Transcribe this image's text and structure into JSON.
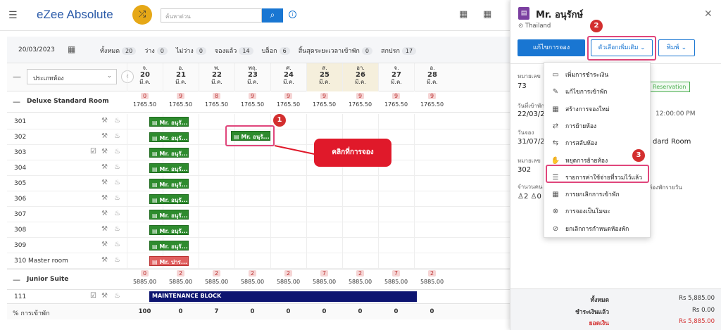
{
  "app": {
    "logo": "eZee Absolute",
    "search_placeholder": "ค้นหาด่วน"
  },
  "filter": {
    "date": "20/03/2023",
    "stats": [
      {
        "label": "ทั้งหมด",
        "value": "20"
      },
      {
        "label": "ว่าง",
        "value": "0"
      },
      {
        "label": "ไม่ว่าง",
        "value": "0"
      },
      {
        "label": "จองแล้ว",
        "value": "14"
      },
      {
        "label": "บล็อก",
        "value": "6"
      },
      {
        "label": "สิ้นสุดระยะเวลาเข้าพัก",
        "value": "0"
      },
      {
        "label": "สกปรก",
        "value": "17"
      }
    ]
  },
  "grid": {
    "room_type_select": "ประเภทห้อง",
    "days": [
      {
        "dow": "จ.",
        "num": "20",
        "mon": "มี.ค."
      },
      {
        "dow": "อ.",
        "num": "21",
        "mon": "มี.ค."
      },
      {
        "dow": "พ.",
        "num": "22",
        "mon": "มี.ค."
      },
      {
        "dow": "พฤ.",
        "num": "23",
        "mon": "มี.ค."
      },
      {
        "dow": "ศ.",
        "num": "24",
        "mon": "มี.ค."
      },
      {
        "dow": "ส.",
        "num": "25",
        "mon": "มี.ค."
      },
      {
        "dow": "อา.",
        "num": "26",
        "mon": "มี.ค."
      },
      {
        "dow": "จ.",
        "num": "27",
        "mon": "มี.ค."
      },
      {
        "dow": "อ.",
        "num": "28",
        "mon": "มี.ค."
      }
    ],
    "deluxe": {
      "name": "Deluxe Standard Room",
      "counts": [
        "0",
        "9",
        "8",
        "9",
        "9",
        "9",
        "9",
        "9",
        "9"
      ],
      "rate": "1765.50"
    },
    "rooms": [
      "301",
      "302",
      "303",
      "304",
      "305",
      "306",
      "307",
      "308",
      "309",
      "310 Master room"
    ],
    "junior": {
      "name": "Junior Suite",
      "counts": [
        "0",
        "2",
        "2",
        "2",
        "2",
        "7",
        "2",
        "7",
        "2"
      ],
      "rate": "5885.00"
    },
    "room_111": "111",
    "maintenance": "MAINTENANCE BLOCK",
    "occupancy_label": "% การเข้าพัก",
    "occupancy": [
      "100",
      "0",
      "7",
      "0",
      "0",
      "0",
      "0",
      "0",
      "0"
    ],
    "booking_label": "Mr. อนุรั...",
    "booking_label_red": "Mr. ปาร...",
    "selected_booking": "Mr. อนุรั..."
  },
  "callout": "คลิกที่การจอง",
  "badges": {
    "b1": "1",
    "b2": "2",
    "b3": "3"
  },
  "panel": {
    "guest": "Mr. อนุรักษ์",
    "country": "Thailand",
    "edit_btn": "แก้ไขการจอง",
    "more_btn": "ตัวเลือกเพิ่มเติม",
    "print_btn": "พิมพ์",
    "f1_label": "หมายเลข",
    "f1_value": "73",
    "status": "Reservation",
    "f2_label": "วันที่เข้าพัก",
    "f2_value": "22/03/2",
    "f2_time": "12:00:00 PM",
    "f3_label": "วันจอง",
    "f3_value": "31/07/2",
    "f3_room": "dard Room",
    "f4_label": "หมายเลข",
    "f4_value": "302",
    "f5_label": "จำนวนคน",
    "f5_value": "2",
    "f5_kid": "0",
    "f5_rate": "ห้องพักรายวัน",
    "total_label": "ทั้งหมด",
    "total": "Rs 5,885.00",
    "paid_label": "ชำระเงินแล้ว",
    "paid": "Rs 0.00",
    "bal_label": "ยอดเงิน",
    "bal": "Rs 5,885.00"
  },
  "menu": [
    "เพิ่มการชำระเงิน",
    "แก้ไขการเข้าพัก",
    "สร้างการจองใหม่",
    "การย้ายห้อง",
    "การสลับห้อง",
    "หยุดการย้ายห้อง",
    "รายการค่าใช้จ่ายที่รวมไว้แล้ว",
    "การยกเลิกการเข้าพัก",
    "การจองเป็นโมฆะ",
    "ยกเลิกการกำหนดห้องพัก"
  ],
  "colors": {
    "accent": "#1976d2",
    "booking": "#2e8b2e",
    "highlight": "#e0457b",
    "callout": "#e0192a"
  }
}
